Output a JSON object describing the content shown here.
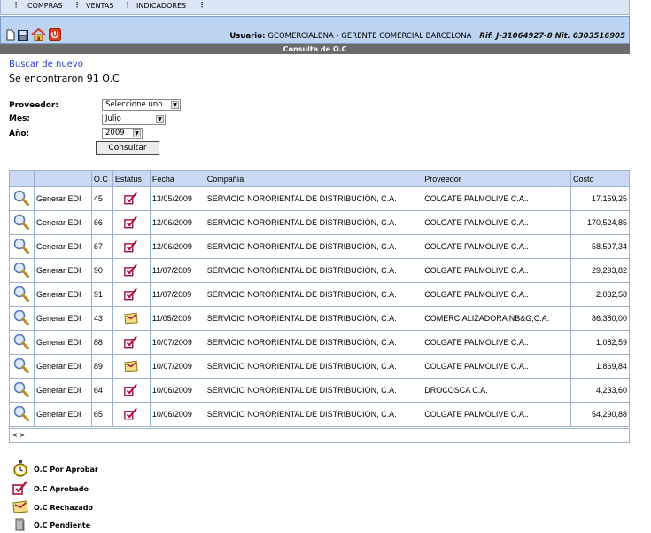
{
  "menu": {
    "items": [
      "COMPRAS",
      "VENTAS",
      "INDICADORES"
    ]
  },
  "user_bar": {
    "user_label": "Usuario:",
    "user_name": "GCOMERCIALBNA - GERENTE COMERCIAL BARCELONA",
    "rif": "Rif. J-31064927-8",
    "nit": "Nit. 0303516905"
  },
  "title": "Consulta de O.C",
  "search_again": "Buscar de nuevo",
  "found_text": "Se encontraron 91 O.C",
  "filters": {
    "proveedor_label": "Proveedor:",
    "proveedor_value": "Seleccione uno",
    "mes_label": "Mes:",
    "mes_value": "Julio",
    "anio_label": "Año:",
    "anio_value": "2009",
    "submit": "Consultar"
  },
  "table": {
    "headers": [
      "",
      "",
      "O.C",
      "Estatus",
      "Fecha",
      "Compañía",
      "Proveedor",
      "Costo"
    ],
    "rows": [
      {
        "action": "Generar EDI",
        "oc": "45",
        "status": "aprobado",
        "fecha": "13/05/2009",
        "compania": "SERVICIO NORORIENTAL DE DISTRIBUCIÓN, C.A.",
        "proveedor": "COLGATE PALMOLIVE C.A..",
        "costo": "17.159,25"
      },
      {
        "action": "Generar EDI",
        "oc": "66",
        "status": "aprobado",
        "fecha": "12/06/2009",
        "compania": "SERVICIO NORORIENTAL DE DISTRIBUCIÓN, C.A.",
        "proveedor": "COLGATE PALMOLIVE C.A..",
        "costo": "170.524,85"
      },
      {
        "action": "Generar EDI",
        "oc": "67",
        "status": "aprobado",
        "fecha": "12/06/2009",
        "compania": "SERVICIO NORORIENTAL DE DISTRIBUCIÓN, C.A.",
        "proveedor": "COLGATE PALMOLIVE C.A..",
        "costo": "58.597,34"
      },
      {
        "action": "Generar EDI",
        "oc": "90",
        "status": "aprobado",
        "fecha": "11/07/2009",
        "compania": "SERVICIO NORORIENTAL DE DISTRIBUCIÓN, C.A.",
        "proveedor": "COLGATE PALMOLIVE C.A..",
        "costo": "29.293,82"
      },
      {
        "action": "Generar EDI",
        "oc": "91",
        "status": "aprobado",
        "fecha": "11/07/2009",
        "compania": "SERVICIO NORORIENTAL DE DISTRIBUCIÓN, C.A.",
        "proveedor": "COLGATE PALMOLIVE C.A..",
        "costo": "2.032,58"
      },
      {
        "action": "Generar EDI",
        "oc": "43",
        "status": "rechazado",
        "fecha": "11/05/2009",
        "compania": "SERVICIO NORORIENTAL DE DISTRIBUCIÓN, C.A.",
        "proveedor": "COMERCIALIZADORA NB&G,C.A.",
        "costo": "86.380,00"
      },
      {
        "action": "Generar EDI",
        "oc": "88",
        "status": "aprobado",
        "fecha": "10/07/2009",
        "compania": "SERVICIO NORORIENTAL DE DISTRIBUCIÓN, C.A.",
        "proveedor": "COLGATE PALMOLIVE C.A..",
        "costo": "1.082,59"
      },
      {
        "action": "Generar EDI",
        "oc": "89",
        "status": "rechazado",
        "fecha": "10/07/2009",
        "compania": "SERVICIO NORORIENTAL DE DISTRIBUCIÓN, C.A.",
        "proveedor": "COLGATE PALMOLIVE C.A..",
        "costo": "1.869,84"
      },
      {
        "action": "Generar EDI",
        "oc": "64",
        "status": "aprobado",
        "fecha": "10/06/2009",
        "compania": "SERVICIO NORORIENTAL DE DISTRIBUCIÓN, C.A.",
        "proveedor": "DROCOSCA C.A.",
        "costo": "4.233,60"
      },
      {
        "action": "Generar EDI",
        "oc": "65",
        "status": "aprobado",
        "fecha": "10/06/2009",
        "compania": "SERVICIO NORORIENTAL DE DISTRIBUCIÓN, C.A.",
        "proveedor": "COLGATE PALMOLIVE C.A..",
        "costo": "54.290,88"
      }
    ],
    "pager": "< >"
  },
  "legend": [
    {
      "icon": "stopwatch-icon",
      "label": "O.C Por Aprobar"
    },
    {
      "icon": "approved-icon",
      "label": "O.C Aprobado"
    },
    {
      "icon": "rejected-icon",
      "label": "O.C Rechazado"
    },
    {
      "icon": "pending-icon",
      "label": "O.C Pendiente"
    }
  ],
  "colors": {
    "header_bg": "#c9daf2",
    "menu_bg": "#dbe6f6",
    "user_bar_bg": "#bcd4f2",
    "title_bg": "#6b6b6b",
    "link": "#2a3ec4"
  }
}
